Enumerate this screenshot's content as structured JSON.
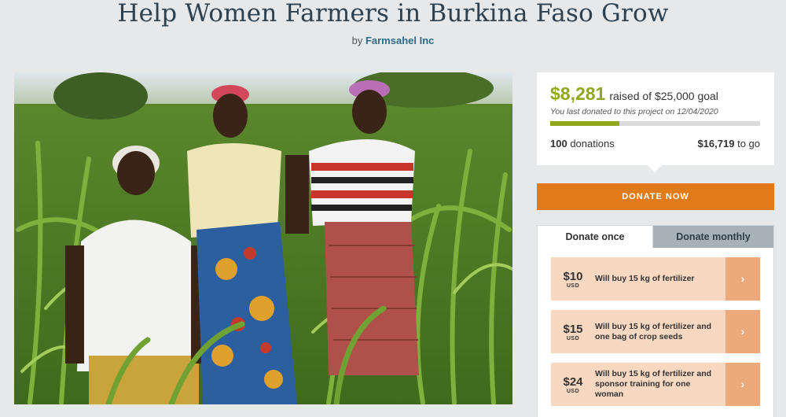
{
  "page": {
    "title": "Help Women Farmers in Burkina Faso Grow",
    "by_prefix": "by",
    "organization": "Farmsahel Inc"
  },
  "photo": {
    "alt": "Three women standing in a maize field"
  },
  "progress": {
    "raised_amount": "$8,281",
    "raised_suffix": "raised of $25,000 goal",
    "last_donated": "You last donated to this project on 12/04/2020",
    "percent_funded": 33.1,
    "donations_count": "100",
    "donations_label": "donations",
    "remaining_amount": "$16,719",
    "remaining_label": "to go"
  },
  "donate_button": {
    "label": "DONATE NOW"
  },
  "colors": {
    "accent_green": "#8fa81f",
    "donate_orange": "#e07b17",
    "option_bg": "#f8d8c1",
    "option_arrow_bg": "#eca97a"
  },
  "tabs": [
    {
      "label": "Donate once",
      "active": true
    },
    {
      "label": "Donate monthly",
      "active": false
    }
  ],
  "options": [
    {
      "amount": "$10",
      "currency": "USD",
      "description": "Will buy 15 kg of fertilizer",
      "arrow_icon": "chevron-right-icon"
    },
    {
      "amount": "$15",
      "currency": "USD",
      "description": "Will buy 15 kg of fertilizer and one bag of crop seeds",
      "arrow_icon": "chevron-right-icon"
    },
    {
      "amount": "$24",
      "currency": "USD",
      "description": "Will buy 15 kg of fertilizer and sponsor training for one woman",
      "arrow_icon": "chevron-right-icon"
    }
  ]
}
